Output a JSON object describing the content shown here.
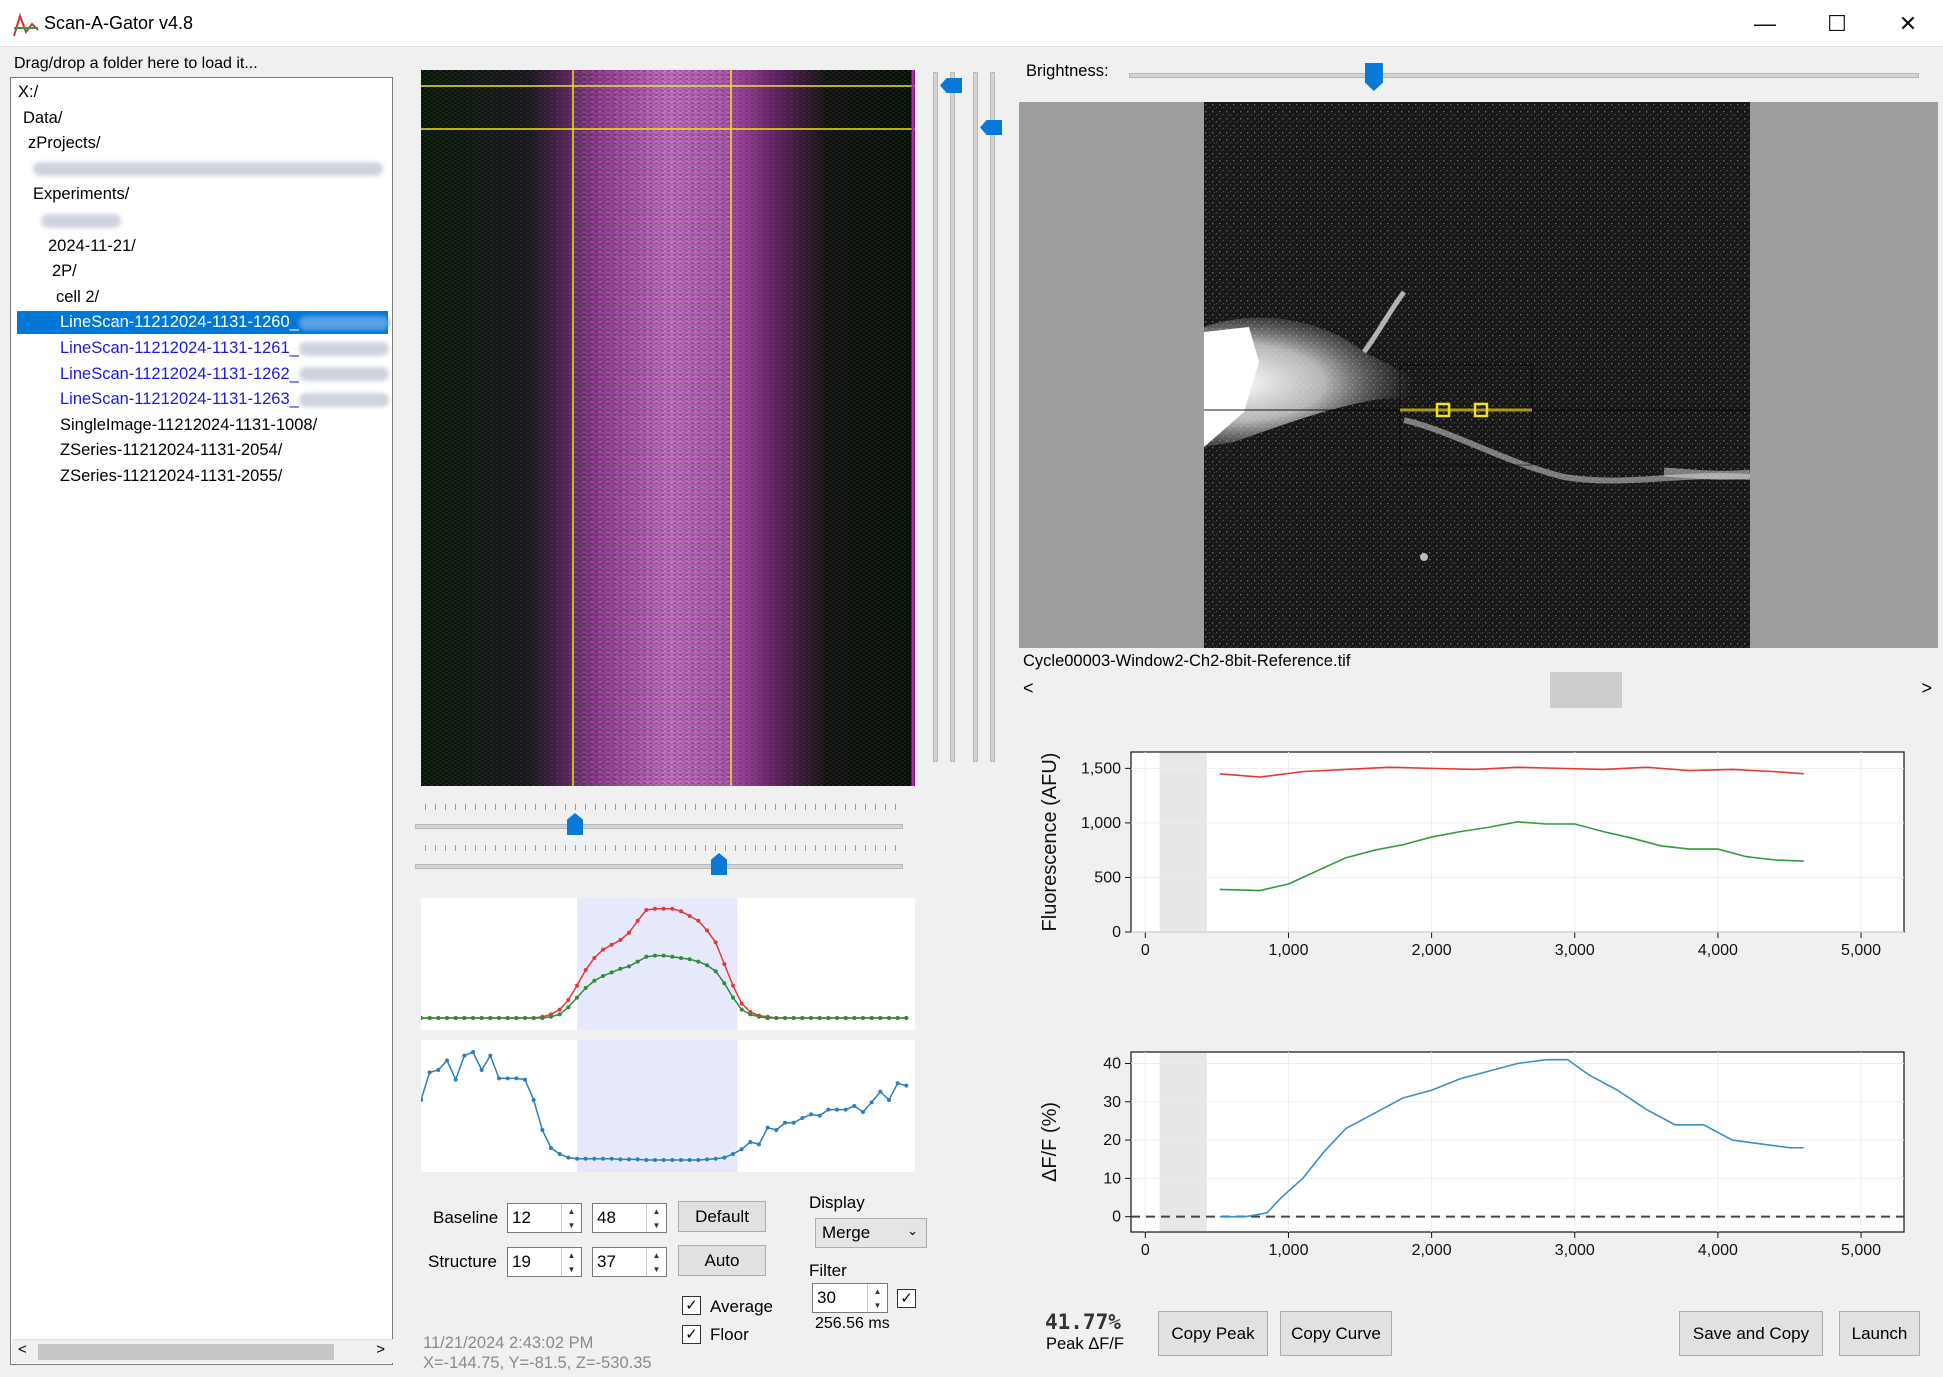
{
  "window": {
    "title": "Scan-A-Gator v4.8",
    "minimize": "—",
    "maximize": "☐",
    "close": "✕"
  },
  "tree": {
    "hint": "Drag/drop a folder here to load it...",
    "items": [
      {
        "label": "X:/",
        "indent": 0
      },
      {
        "label": "Data/",
        "indent": 1
      },
      {
        "label": "zProjects/",
        "indent": 2
      },
      {
        "label": "",
        "indent": 3,
        "redacted": true
      },
      {
        "label": "Experiments/",
        "indent": 3
      },
      {
        "label": "",
        "indent": 4,
        "redacted": true
      },
      {
        "label": "2024-11-21/",
        "indent": 4
      },
      {
        "label": "2P/",
        "indent": 5
      },
      {
        "label": "cell 2/",
        "indent": 6
      },
      {
        "label": "LineScan-11212024-1131-1260_",
        "indent": 7,
        "selected": true
      },
      {
        "label": "LineScan-11212024-1131-1261_",
        "indent": 7,
        "link": true
      },
      {
        "label": "LineScan-11212024-1131-1262_",
        "indent": 7,
        "link": true
      },
      {
        "label": "LineScan-11212024-1131-1263_",
        "indent": 7,
        "link": true
      },
      {
        "label": "SingleImage-11212024-1131-1008/",
        "indent": 7
      },
      {
        "label": "ZSeries-11212024-1131-2054/",
        "indent": 7
      },
      {
        "label": "ZSeries-11212024-1131-2055/",
        "indent": 7
      }
    ],
    "scroll_left": "<",
    "scroll_right": ">"
  },
  "controls": {
    "baseline_label": "Baseline",
    "baseline_start": "12",
    "baseline_end": "48",
    "structure_label": "Structure",
    "structure_start": "19",
    "structure_end": "37",
    "default_button": "Default",
    "auto_button": "Auto",
    "display_label": "Display",
    "display_value": "Merge",
    "filter_label": "Filter",
    "filter_value": "30",
    "filter_ms": "256.56 ms",
    "average_label": "Average",
    "floor_label": "Floor",
    "timestamp": "11/21/2024 2:43:02 PM",
    "coords": "X=-144.75, Y=-81.5, Z=-530.35"
  },
  "reference": {
    "brightness_label": "Brightness:",
    "brightness_level": 0.31,
    "filename": "Cycle00003-Window2-Ch2-8bit-Reference.tif",
    "scroll_left": "<",
    "scroll_right": ">"
  },
  "results": {
    "peak_value": "41.77%",
    "peak_label": "Peak ΔF/F",
    "copy_peak": "Copy Peak",
    "copy_curve": "Copy Curve",
    "save_and_copy": "Save and Copy",
    "launch": "Launch"
  },
  "chart_data": [
    {
      "type": "line",
      "ylabel": "Fluorescence (AFU)",
      "xlabel": "",
      "xlim": [
        -100,
        5300
      ],
      "ylim": [
        0,
        1650
      ],
      "xticks": [
        "0",
        "1,000",
        "2,000",
        "3,000",
        "4,000",
        "5,000"
      ],
      "yticks": [
        "0",
        "500",
        "1,000",
        "1,500"
      ],
      "baseline_span": [
        100,
        430
      ],
      "series": [
        {
          "color": "#e53935",
          "x": [
            520,
            800,
            1100,
            1400,
            1700,
            2000,
            2300,
            2600,
            2900,
            3200,
            3500,
            3800,
            4100,
            4400,
            4600
          ],
          "y": [
            1450,
            1420,
            1470,
            1490,
            1510,
            1500,
            1490,
            1510,
            1500,
            1490,
            1510,
            1480,
            1490,
            1470,
            1450
          ]
        },
        {
          "color": "#2e9e3a",
          "x": [
            520,
            800,
            1000,
            1200,
            1400,
            1600,
            1800,
            2000,
            2200,
            2400,
            2600,
            2800,
            3000,
            3200,
            3400,
            3600,
            3800,
            4000,
            4200,
            4400,
            4600
          ],
          "y": [
            390,
            380,
            440,
            560,
            680,
            750,
            800,
            870,
            920,
            960,
            1010,
            990,
            990,
            920,
            860,
            790,
            760,
            760,
            690,
            660,
            650
          ]
        }
      ]
    },
    {
      "type": "line",
      "ylabel": "ΔF/F (%)",
      "xlabel": "",
      "xlim": [
        -100,
        5300
      ],
      "ylim": [
        -4,
        43
      ],
      "xticks": [
        "0",
        "1,000",
        "2,000",
        "3,000",
        "4,000",
        "5,000"
      ],
      "yticks": [
        "0",
        "10",
        "20",
        "30",
        "40"
      ],
      "baseline_span": [
        100,
        430
      ],
      "zero_line": true,
      "series": [
        {
          "color": "#3a8fc8",
          "x": [
            520,
            700,
            850,
            950,
            1100,
            1250,
            1400,
            1600,
            1800,
            2000,
            2200,
            2400,
            2600,
            2800,
            2950,
            3100,
            3300,
            3500,
            3700,
            3900,
            4100,
            4300,
            4500,
            4600
          ],
          "y": [
            0,
            0,
            1,
            5,
            10,
            17,
            23,
            27,
            31,
            33,
            36,
            38,
            40,
            41,
            41,
            37,
            33,
            28,
            24,
            24,
            20,
            19,
            18,
            18
          ]
        }
      ]
    },
    {
      "type": "line",
      "ylabel": "",
      "xlabel": "",
      "xlim": [
        0,
        57
      ],
      "ylim": [
        0,
        1
      ],
      "xticks": [],
      "yticks": [],
      "highlight_span": [
        18,
        36.5
      ],
      "series": [
        {
          "color": "#e53935",
          "values": [
            0.05,
            0.05,
            0.05,
            0.05,
            0.05,
            0.05,
            0.05,
            0.05,
            0.05,
            0.05,
            0.05,
            0.05,
            0.05,
            0.05,
            0.06,
            0.08,
            0.12,
            0.2,
            0.32,
            0.45,
            0.55,
            0.62,
            0.66,
            0.7,
            0.76,
            0.86,
            0.95,
            0.96,
            0.96,
            0.96,
            0.94,
            0.9,
            0.86,
            0.78,
            0.68,
            0.5,
            0.32,
            0.17,
            0.1,
            0.07,
            0.06,
            0.05,
            0.05,
            0.05,
            0.05,
            0.05,
            0.05,
            0.05,
            0.05,
            0.05,
            0.05,
            0.05,
            0.05,
            0.05,
            0.05,
            0.05,
            0.05
          ]
        },
        {
          "color": "#2e8b3a",
          "values": [
            0.05,
            0.05,
            0.05,
            0.05,
            0.05,
            0.05,
            0.05,
            0.05,
            0.05,
            0.05,
            0.05,
            0.05,
            0.05,
            0.05,
            0.05,
            0.06,
            0.08,
            0.14,
            0.22,
            0.3,
            0.36,
            0.4,
            0.43,
            0.46,
            0.48,
            0.52,
            0.56,
            0.57,
            0.57,
            0.56,
            0.55,
            0.54,
            0.52,
            0.49,
            0.44,
            0.34,
            0.22,
            0.12,
            0.08,
            0.06,
            0.05,
            0.05,
            0.05,
            0.05,
            0.05,
            0.05,
            0.05,
            0.05,
            0.05,
            0.05,
            0.05,
            0.05,
            0.05,
            0.05,
            0.05,
            0.05,
            0.05
          ]
        }
      ]
    },
    {
      "type": "line",
      "ylabel": "",
      "xlabel": "",
      "xlim": [
        0,
        57
      ],
      "ylim": [
        0,
        1
      ],
      "xticks": [],
      "yticks": [],
      "highlight_span": [
        18,
        36.5
      ],
      "series": [
        {
          "color": "#2a7fc1",
          "values": [
            0.55,
            0.78,
            0.8,
            0.88,
            0.72,
            0.92,
            0.95,
            0.8,
            0.92,
            0.73,
            0.73,
            0.73,
            0.72,
            0.55,
            0.3,
            0.15,
            0.1,
            0.07,
            0.06,
            0.06,
            0.06,
            0.06,
            0.06,
            0.055,
            0.055,
            0.055,
            0.05,
            0.05,
            0.05,
            0.05,
            0.05,
            0.05,
            0.05,
            0.055,
            0.06,
            0.07,
            0.1,
            0.14,
            0.2,
            0.18,
            0.32,
            0.3,
            0.36,
            0.36,
            0.4,
            0.43,
            0.42,
            0.47,
            0.47,
            0.47,
            0.5,
            0.45,
            0.53,
            0.62,
            0.55,
            0.69,
            0.67
          ]
        }
      ]
    }
  ]
}
